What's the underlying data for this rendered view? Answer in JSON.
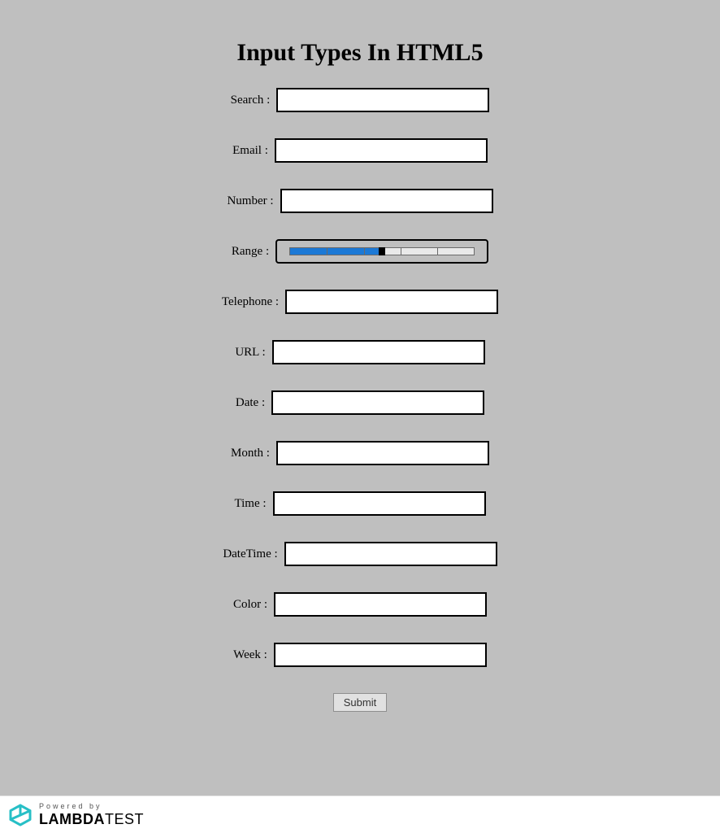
{
  "title": "Input Types In HTML5",
  "fields": {
    "search": {
      "label": "Search :"
    },
    "email": {
      "label": "Email :"
    },
    "number": {
      "label": "Number :"
    },
    "range": {
      "label": "Range :",
      "value": 50,
      "min": 0,
      "max": 100
    },
    "telephone": {
      "label": "Telephone :"
    },
    "url": {
      "label": "URL :"
    },
    "date": {
      "label": "Date :"
    },
    "month": {
      "label": "Month :"
    },
    "time": {
      "label": "Time :"
    },
    "datetime": {
      "label": "DateTime :"
    },
    "color": {
      "label": "Color :"
    },
    "week": {
      "label": "Week :"
    }
  },
  "submit_label": "Submit",
  "footer": {
    "powered_by": "Powered by",
    "brand_bold": "LAMBDA",
    "brand_thin": "TEST",
    "accent": "#27bfc6"
  }
}
